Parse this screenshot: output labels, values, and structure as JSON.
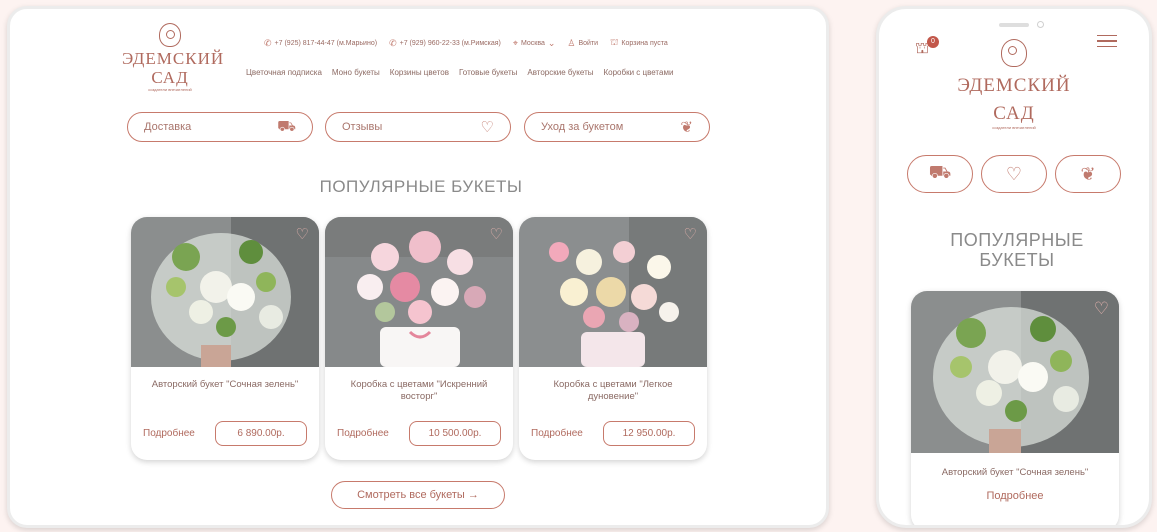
{
  "brand": {
    "title_line1": "ЭДЕМСКИЙ",
    "title_line2": "САД",
    "tagline": "создатели впечатлений"
  },
  "topbar": {
    "phone1": "+7 (925) 817-44-47 (м.Марьино)",
    "phone2": "+7 (929) 960-22-33 (м.Римская)",
    "city": "Москва",
    "login": "Войти",
    "cart": "Корзина пуста"
  },
  "nav": [
    "Цветочная подписка",
    "Моно букеты",
    "Корзины цветов",
    "Готовые букеты",
    "Авторские букеты",
    "Коробки с цветами"
  ],
  "quick_links": [
    {
      "label": "Доставка",
      "icon": "truck-icon"
    },
    {
      "label": "Отзывы",
      "icon": "reviews-icon"
    },
    {
      "label": "Уход за букетом",
      "icon": "care-hand-icon"
    }
  ],
  "section_title": "ПОПУЛЯРНЫЕ БУКЕТЫ",
  "products": [
    {
      "name": "Авторский букет \"Сочная зелень\"",
      "more": "Подробнее",
      "price": "6 890.00р."
    },
    {
      "name": "Коробка с цветами \"Искренний восторг\"",
      "more": "Подробнее",
      "price": "10 500.00р."
    },
    {
      "name": "Коробка с цветами \"Легкое дуновение\"",
      "more": "Подробнее",
      "price": "12 950.00р."
    }
  ],
  "all_button": "Смотреть все букеты →",
  "mobile": {
    "cart_count": "0",
    "section_title_line1": "ПОПУЛЯРНЫЕ",
    "section_title_line2": "БУКЕТЫ",
    "product_name": "Авторский букет \"Сочная зелень\"",
    "product_more": "Подробнее"
  },
  "colors": {
    "accent": "#c77a6c",
    "badge": "#c2574a"
  }
}
